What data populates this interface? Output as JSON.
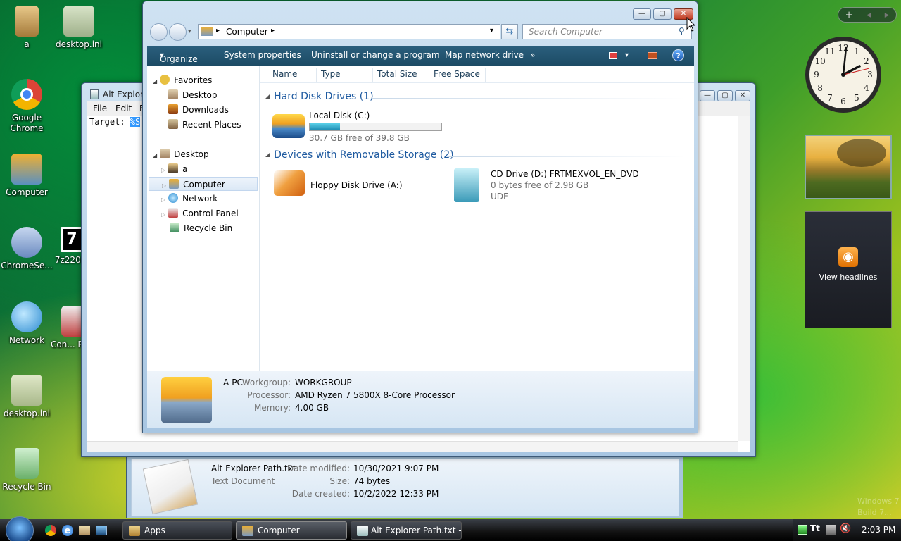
{
  "desktop": {
    "icons": [
      {
        "label": "a"
      },
      {
        "label": "desktop.ini"
      },
      {
        "label": "Google Chrome"
      },
      {
        "label": "Computer"
      },
      {
        "label": "ChromeSe..."
      },
      {
        "label": "7z220..."
      },
      {
        "label": "Network"
      },
      {
        "label": "Con... Pa..."
      },
      {
        "label": "desktop.ini"
      },
      {
        "label": "Recycle Bin"
      }
    ],
    "watermark": [
      "Windows 7",
      "Build 7..."
    ]
  },
  "gadgets": {
    "sidebar_buttons": [
      "+",
      "◂",
      "▸"
    ],
    "clock": {
      "numbers": [
        "12",
        "1",
        "2",
        "3",
        "4",
        "5",
        "6",
        "7",
        "8",
        "9",
        "10",
        "11"
      ]
    },
    "feed_label": "View headlines"
  },
  "notepad": {
    "title": "Alt Explore",
    "menu": [
      "File",
      "Edit",
      "F"
    ],
    "content": "Target: ",
    "selected_text": "%S"
  },
  "explorer": {
    "address": "Computer",
    "search_placeholder": "Search Computer",
    "toolbar": [
      "Organize",
      "System properties",
      "Uninstall or change a program",
      "Map network drive",
      "»"
    ],
    "nav": {
      "favorites": "Favorites",
      "favorites_items": [
        "Desktop",
        "Downloads",
        "Recent Places"
      ],
      "desktop": "Desktop",
      "desktop_items": [
        "a",
        "Computer",
        "Network",
        "Control Panel",
        "Recycle Bin"
      ]
    },
    "columns": [
      "Name",
      "Type",
      "Total Size",
      "Free Space"
    ],
    "groups": [
      {
        "title": "Hard Disk Drives (1)"
      },
      {
        "title": "Devices with Removable Storage (2)"
      }
    ],
    "local_disk": {
      "name": "Local Disk (C:)",
      "free": "30.7 GB free of 39.8 GB",
      "used_fraction": 0.23
    },
    "floppy": {
      "name": "Floppy Disk Drive (A:)"
    },
    "cd": {
      "name": "CD Drive (D:) FRTMEXVOL_EN_DVD",
      "free": "0 bytes free of 2.98 GB",
      "fs": "UDF"
    },
    "details": {
      "name": "A-PC",
      "workgroup_label": "Workgroup:",
      "workgroup": "WORKGROUP",
      "processor_label": "Processor:",
      "processor": "AMD Ryzen 7 5800X 8-Core Processor",
      "memory_label": "Memory:",
      "memory": "4.00 GB"
    }
  },
  "file_details": {
    "name": "Alt Explorer Path.txt",
    "type": "Text Document",
    "modified_label": "Date modified:",
    "modified": "10/30/2021 9:07 PM",
    "size_label": "Size:",
    "size": "74 bytes",
    "created_label": "Date created:",
    "created": "10/2/2022 12:33 PM"
  },
  "taskbar": {
    "buttons": [
      "Apps",
      "Computer",
      "Alt Explorer Path.txt - ..."
    ],
    "clock": "2:03 PM"
  }
}
